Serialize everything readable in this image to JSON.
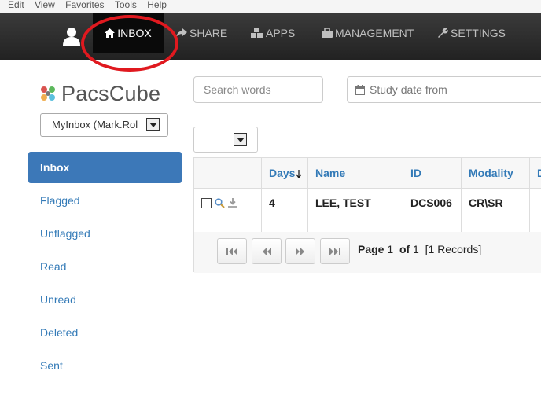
{
  "menubar": {
    "items": [
      "Edit",
      "View",
      "Favorites",
      "Tools",
      "Help"
    ]
  },
  "nav": {
    "items": [
      {
        "label": "INBOX",
        "icon": "home-icon",
        "active": true
      },
      {
        "label": "SHARE",
        "icon": "share-icon"
      },
      {
        "label": "APPS",
        "icon": "cubes-icon"
      },
      {
        "label": "MANAGEMENT",
        "icon": "briefcase-icon"
      },
      {
        "label": "SETTINGS",
        "icon": "wrench-icon"
      }
    ],
    "highlight_color": "#e0191f"
  },
  "logo": {
    "text": "PacsCube"
  },
  "inbox_select": {
    "value": "MyInbox (Mark.Rol"
  },
  "sidebar": {
    "items": [
      {
        "label": "Inbox",
        "active": true
      },
      {
        "label": "Flagged"
      },
      {
        "label": "Unflagged"
      },
      {
        "label": "Read"
      },
      {
        "label": "Unread"
      },
      {
        "label": "Deleted"
      },
      {
        "label": "Sent"
      }
    ]
  },
  "filters": {
    "search_placeholder": "Search words",
    "date_from_placeholder": "Study date from",
    "page_size_value": ""
  },
  "grid": {
    "columns": [
      "",
      "Days",
      "Name",
      "ID",
      "Modality",
      "D"
    ],
    "rows": [
      {
        "days": "4",
        "name": "LEE, TEST",
        "id": "DCS006",
        "modality": "CR\\SR"
      }
    ]
  },
  "pager": {
    "page_label": "Page",
    "page": "1",
    "of_label": "of",
    "total": "1",
    "records": "[1 Records]"
  },
  "colors": {
    "accent": "#337ab7",
    "sidebar_active": "#3c78b8",
    "navbar": "#2b2b2b"
  }
}
